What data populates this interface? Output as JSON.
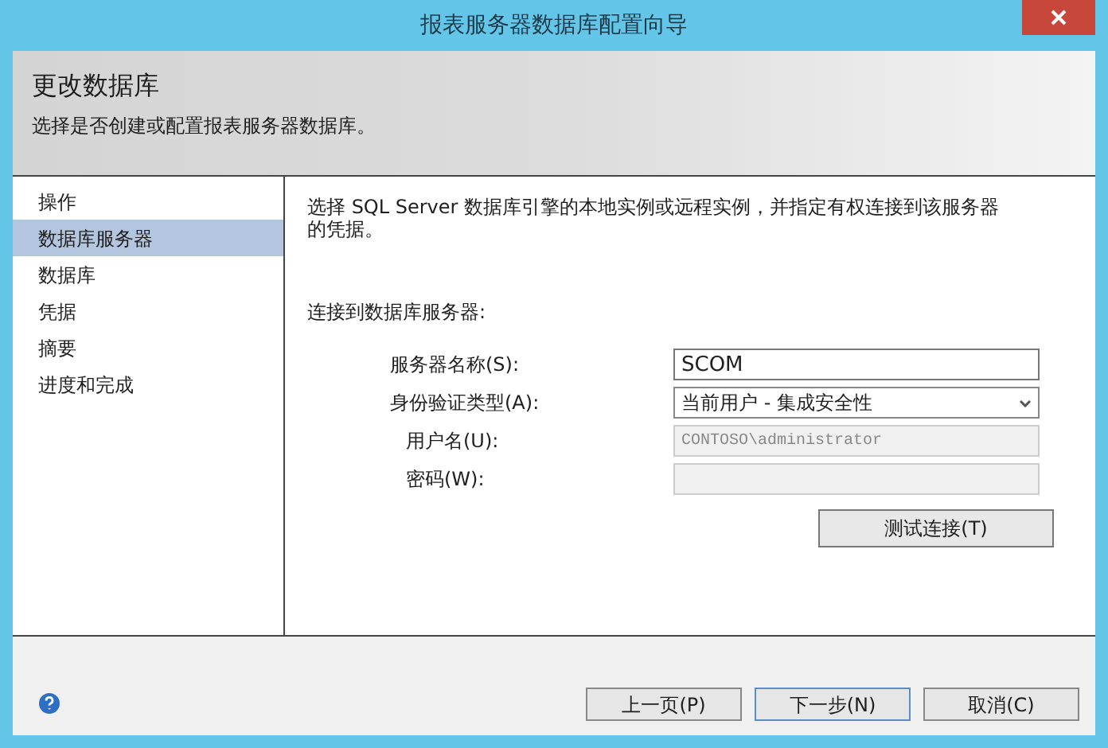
{
  "window": {
    "title": "报表服务器数据库配置向导"
  },
  "header": {
    "title": "更改数据库",
    "subtitle": "选择是否创建或配置报表服务器数据库。"
  },
  "nav": [
    {
      "label": "操作",
      "selected": false
    },
    {
      "label": "数据库服务器",
      "selected": true
    },
    {
      "label": "数据库",
      "selected": false
    },
    {
      "label": "凭据",
      "selected": false
    },
    {
      "label": "摘要",
      "selected": false
    },
    {
      "label": "进度和完成",
      "selected": false
    }
  ],
  "description": "选择 SQL Server 数据库引擎的本地实例或远程实例，并指定有权连接到该服务器的凭据。",
  "section_label": "连接到数据库服务器:",
  "fields": [
    {
      "kind": "text",
      "label": "服务器名称(S):",
      "value": "SCOM",
      "disabled": false
    },
    {
      "kind": "select",
      "label": "身份验证类型(A):",
      "value": "当前用户 - 集成安全性",
      "disabled": false
    },
    {
      "kind": "text",
      "label": "用户名(U):",
      "value": "CONTOSO\\administrator",
      "disabled": true
    },
    {
      "kind": "text",
      "label": "密码(W):",
      "disabled": true
    }
  ],
  "test_button": "测试连接(T)",
  "buttons": [
    "上一页(P)",
    "下一步(N)",
    "取消(C)"
  ]
}
